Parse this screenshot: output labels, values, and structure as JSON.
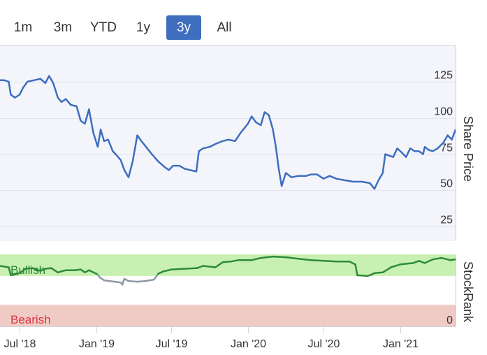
{
  "range_buttons": [
    {
      "label": "1m",
      "active": false
    },
    {
      "label": "3m",
      "active": false
    },
    {
      "label": "YTD",
      "active": false
    },
    {
      "label": "1y",
      "active": false
    },
    {
      "label": "3y",
      "active": true
    },
    {
      "label": "All",
      "active": false
    }
  ],
  "colors": {
    "accent": "#3f6ebf",
    "price_line": "#3d6ebf",
    "bullish_zone": "#c9f0b3",
    "bearish_zone": "#f0cbc6",
    "bullish_line": "#2e8b3a",
    "neutral_line": "#8d98a6",
    "plot_bg": "#f4f5fb",
    "bearish_text": "#d9363e",
    "bullish_text": "#2e8b3a"
  },
  "chart_data": {
    "type": "line",
    "x_tick_labels": [
      "Jul '18",
      "Jan '19",
      "Jul '19",
      "Jan '20",
      "Jul '20",
      "Jan '21"
    ],
    "x_ticks": [
      "2018-07-01",
      "2019-01-01",
      "2019-07-01",
      "2020-01-01",
      "2020-07-01",
      "2021-01-01"
    ],
    "xlim": [
      "2018-05-15",
      "2021-05-14"
    ],
    "panels": [
      {
        "name": "price",
        "ylabel": "Share Price",
        "ylim": [
          15,
          150
        ],
        "y_ticks": [
          25,
          50,
          75,
          100,
          125
        ],
        "series": [
          {
            "points": [
              [
                "2018-05-15",
                126
              ],
              [
                "2018-05-25",
                126
              ],
              [
                "2018-06-05",
                125
              ],
              [
                "2018-06-10",
                116
              ],
              [
                "2018-06-20",
                114
              ],
              [
                "2018-07-01",
                116
              ],
              [
                "2018-07-10",
                121
              ],
              [
                "2018-07-20",
                125
              ],
              [
                "2018-08-05",
                126
              ],
              [
                "2018-08-20",
                127
              ],
              [
                "2018-09-01",
                124
              ],
              [
                "2018-09-10",
                129
              ],
              [
                "2018-09-20",
                124
              ],
              [
                "2018-10-01",
                114
              ],
              [
                "2018-10-10",
                111
              ],
              [
                "2018-10-20",
                113
              ],
              [
                "2018-11-01",
                109
              ],
              [
                "2018-11-15",
                108
              ],
              [
                "2018-11-25",
                98
              ],
              [
                "2018-12-05",
                96
              ],
              [
                "2018-12-15",
                106
              ],
              [
                "2018-12-25",
                90
              ],
              [
                "2019-01-05",
                80
              ],
              [
                "2019-01-12",
                92
              ],
              [
                "2019-01-20",
                84
              ],
              [
                "2019-01-30",
                85
              ],
              [
                "2019-02-10",
                77
              ],
              [
                "2019-02-20",
                74
              ],
              [
                "2019-03-01",
                71
              ],
              [
                "2019-03-10",
                64
              ],
              [
                "2019-03-20",
                59
              ],
              [
                "2019-03-30",
                70
              ],
              [
                "2019-04-10",
                88
              ],
              [
                "2019-04-20",
                84
              ],
              [
                "2019-05-01",
                80
              ],
              [
                "2019-05-15",
                75
              ],
              [
                "2019-05-30",
                70
              ],
              [
                "2019-06-15",
                66
              ],
              [
                "2019-06-25",
                64
              ],
              [
                "2019-07-05",
                67
              ],
              [
                "2019-07-20",
                67
              ],
              [
                "2019-08-01",
                65
              ],
              [
                "2019-08-15",
                64
              ],
              [
                "2019-08-30",
                63
              ],
              [
                "2019-09-05",
                77
              ],
              [
                "2019-09-15",
                79
              ],
              [
                "2019-10-01",
                80
              ],
              [
                "2019-10-15",
                82
              ],
              [
                "2019-11-01",
                84
              ],
              [
                "2019-11-15",
                85
              ],
              [
                "2019-12-01",
                84
              ],
              [
                "2019-12-15",
                90
              ],
              [
                "2020-01-01",
                96
              ],
              [
                "2020-01-10",
                101
              ],
              [
                "2020-01-20",
                97
              ],
              [
                "2020-02-01",
                95
              ],
              [
                "2020-02-10",
                104
              ],
              [
                "2020-02-20",
                102
              ],
              [
                "2020-03-01",
                92
              ],
              [
                "2020-03-08",
                80
              ],
              [
                "2020-03-15",
                65
              ],
              [
                "2020-03-22",
                53
              ],
              [
                "2020-04-01",
                62
              ],
              [
                "2020-04-15",
                59
              ],
              [
                "2020-05-01",
                60
              ],
              [
                "2020-05-20",
                60
              ],
              [
                "2020-06-01",
                61
              ],
              [
                "2020-06-15",
                61
              ],
              [
                "2020-07-01",
                58
              ],
              [
                "2020-07-15",
                60
              ],
              [
                "2020-08-01",
                58
              ],
              [
                "2020-08-20",
                57
              ],
              [
                "2020-09-10",
                56
              ],
              [
                "2020-10-01",
                56
              ],
              [
                "2020-10-20",
                55
              ],
              [
                "2020-10-31",
                51
              ],
              [
                "2020-11-10",
                57
              ],
              [
                "2020-11-20",
                62
              ],
              [
                "2020-11-26",
                75
              ],
              [
                "2020-12-05",
                74
              ],
              [
                "2020-12-15",
                73
              ],
              [
                "2020-12-25",
                79
              ],
              [
                "2021-01-05",
                76
              ],
              [
                "2021-01-15",
                73
              ],
              [
                "2021-01-25",
                79
              ],
              [
                "2021-02-05",
                77
              ],
              [
                "2021-02-15",
                77
              ],
              [
                "2021-02-25",
                75
              ],
              [
                "2021-03-01",
                80
              ],
              [
                "2021-03-10",
                78
              ],
              [
                "2021-03-20",
                77
              ],
              [
                "2021-04-01",
                79
              ],
              [
                "2021-04-15",
                83
              ],
              [
                "2021-04-25",
                88
              ],
              [
                "2021-05-05",
                85
              ],
              [
                "2021-05-14",
                92
              ]
            ]
          }
        ]
      },
      {
        "name": "stockrank",
        "ylabel": "StockRank",
        "ylim": [
          0,
          100
        ],
        "y_ticks": [
          0
        ],
        "bands": [
          {
            "label": "Bullish",
            "from": 70,
            "to": 100
          },
          {
            "label": "Bearish",
            "from": 0,
            "to": 30
          }
        ],
        "series": [
          {
            "points": [
              [
                "2018-05-15",
                84
              ],
              [
                "2018-06-05",
                82
              ],
              [
                "2018-06-10",
                71
              ],
              [
                "2018-06-20",
                72
              ],
              [
                "2018-07-01",
                74
              ],
              [
                "2018-07-15",
                80
              ],
              [
                "2018-08-01",
                81
              ],
              [
                "2018-08-20",
                77
              ],
              [
                "2018-09-01",
                80
              ],
              [
                "2018-09-15",
                81
              ],
              [
                "2018-10-01",
                75
              ],
              [
                "2018-10-20",
                78
              ],
              [
                "2018-11-10",
                78
              ],
              [
                "2018-11-25",
                79
              ],
              [
                "2018-12-05",
                75
              ],
              [
                "2018-12-15",
                78
              ],
              [
                "2019-01-05",
                72
              ],
              [
                "2019-01-10",
                68
              ],
              [
                "2019-01-20",
                64
              ],
              [
                "2019-02-15",
                62
              ],
              [
                "2019-03-01",
                61
              ],
              [
                "2019-03-05",
                58
              ],
              [
                "2019-03-10",
                66
              ],
              [
                "2019-03-20",
                63
              ],
              [
                "2019-04-10",
                62
              ],
              [
                "2019-04-30",
                63
              ],
              [
                "2019-05-20",
                65
              ],
              [
                "2019-05-30",
                73
              ],
              [
                "2019-06-10",
                76
              ],
              [
                "2019-07-01",
                79
              ],
              [
                "2019-08-01",
                80
              ],
              [
                "2019-09-01",
                81
              ],
              [
                "2019-09-15",
                84
              ],
              [
                "2019-10-15",
                82
              ],
              [
                "2019-11-01",
                89
              ],
              [
                "2019-11-20",
                90
              ],
              [
                "2019-12-10",
                92
              ],
              [
                "2020-01-10",
                92
              ],
              [
                "2020-02-01",
                95
              ],
              [
                "2020-03-01",
                97
              ],
              [
                "2020-04-01",
                96
              ],
              [
                "2020-05-01",
                94
              ],
              [
                "2020-06-01",
                92
              ],
              [
                "2020-07-01",
                91
              ],
              [
                "2020-08-01",
                90
              ],
              [
                "2020-09-01",
                90
              ],
              [
                "2020-09-15",
                86
              ],
              [
                "2020-09-20",
                71
              ],
              [
                "2020-10-15",
                70
              ],
              [
                "2020-11-01",
                74
              ],
              [
                "2020-11-20",
                75
              ],
              [
                "2020-12-10",
                82
              ],
              [
                "2021-01-01",
                86
              ],
              [
                "2021-02-01",
                88
              ],
              [
                "2021-02-15",
                91
              ],
              [
                "2021-03-01",
                88
              ],
              [
                "2021-03-20",
                93
              ],
              [
                "2021-04-10",
                95
              ],
              [
                "2021-05-01",
                92
              ],
              [
                "2021-05-14",
                93
              ]
            ]
          }
        ]
      }
    ]
  }
}
